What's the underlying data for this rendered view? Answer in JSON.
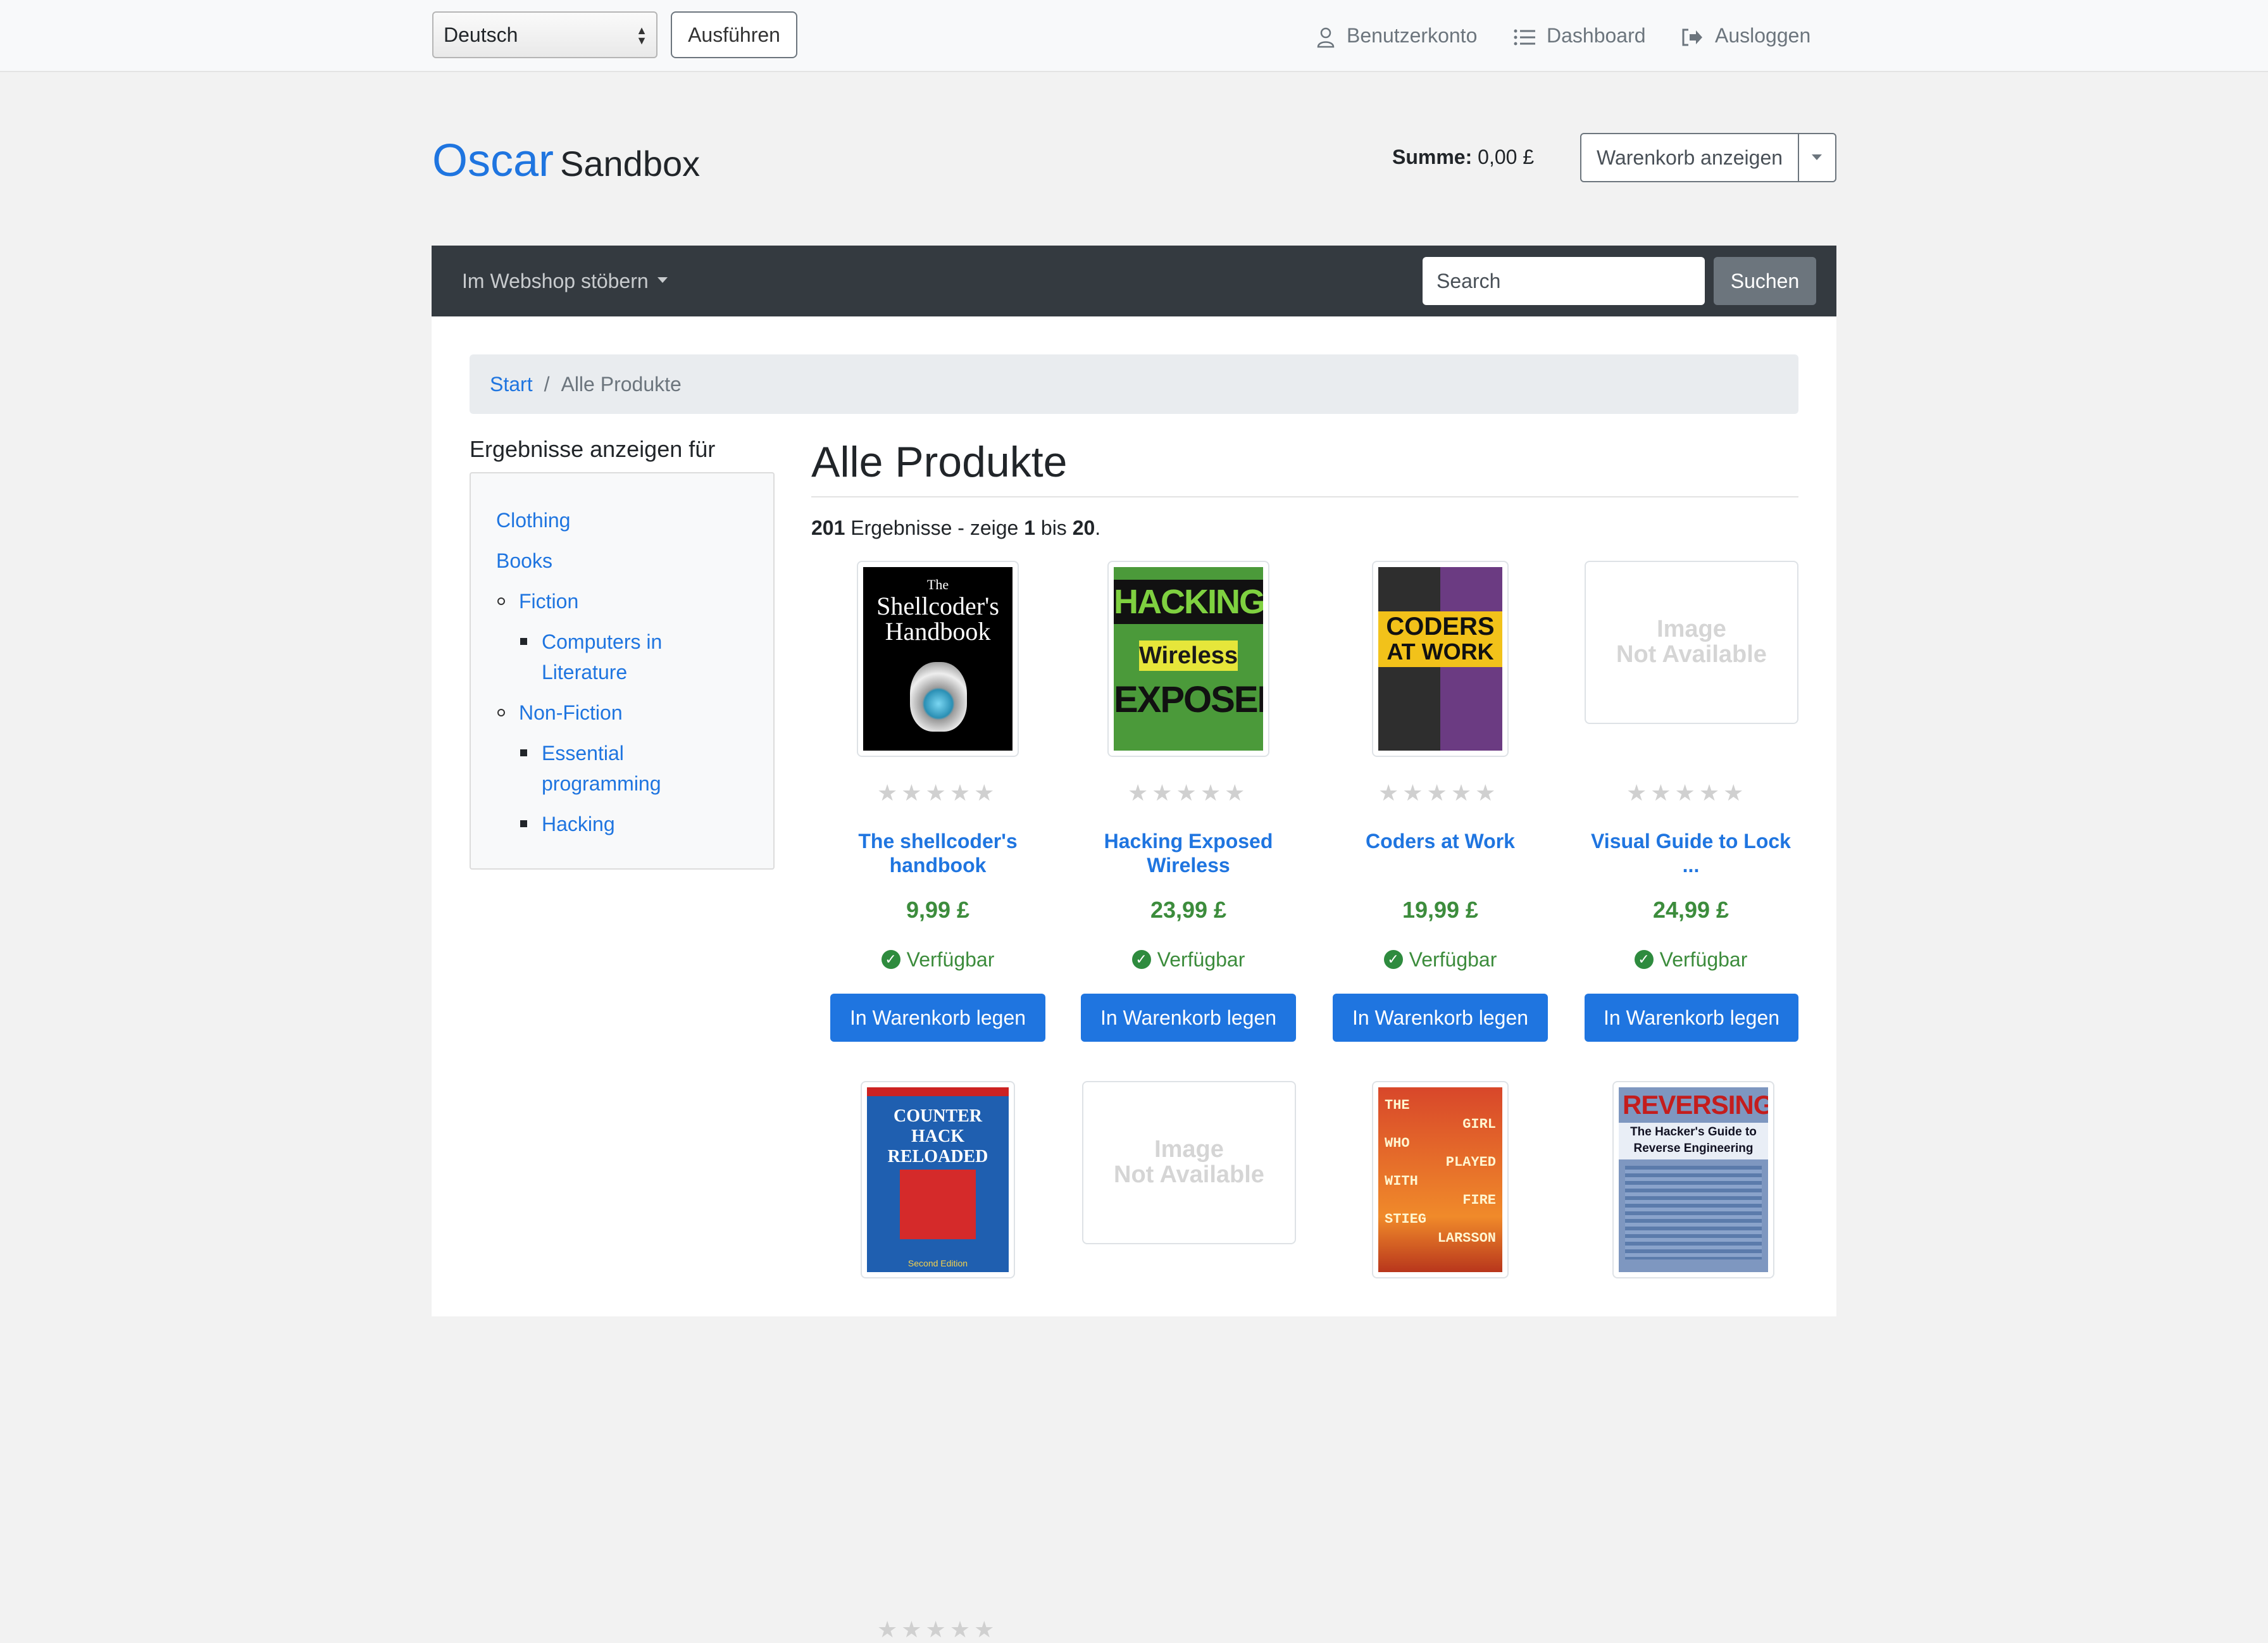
{
  "topbar": {
    "language": "Deutsch",
    "apply_label": "Ausführen",
    "account_label": "Benutzerkonto",
    "dashboard_label": "Dashboard",
    "logout_label": "Ausloggen"
  },
  "header": {
    "brand_primary": "Oscar",
    "brand_secondary": "Sandbox",
    "total_label": "Summe:",
    "total_value": "0,00 £",
    "basket_button": "Warenkorb anzeigen"
  },
  "nav": {
    "browse_label": "Im Webshop stöbern",
    "search_placeholder": "Search",
    "search_button": "Suchen"
  },
  "breadcrumb": {
    "home": "Start",
    "current": "Alle Produkte"
  },
  "filter": {
    "title": "Ergebnisse anzeigen für",
    "categories": {
      "clothing": "Clothing",
      "books": "Books",
      "fiction": "Fiction",
      "computers_lit_1": "Computers in",
      "computers_lit_2": "Literature",
      "non_fiction": "Non-Fiction",
      "essential_1": "Essential",
      "essential_2": "programming",
      "hacking": "Hacking"
    }
  },
  "main": {
    "title": "Alle Produkte",
    "results_count": "201",
    "results_mid": "Ergebnisse - zeige",
    "results_from": "1",
    "results_to_word": "bis",
    "results_to": "20",
    "results_end": "."
  },
  "products": [
    {
      "title_1": "The shellcoder's",
      "title_2": "handbook",
      "price": "9,99 £",
      "availability": "Verfügbar",
      "add_label": "In Warenkorb legen",
      "rating": 0,
      "cover_lines": [
        "The",
        "Shellcoder's",
        "Handbook"
      ]
    },
    {
      "title_1": "Hacking Exposed",
      "title_2": "Wireless",
      "price": "23,99 £",
      "availability": "Verfügbar",
      "add_label": "In Warenkorb legen",
      "rating": 0,
      "cover_lines": [
        "HACKING",
        "Wireless",
        "EXPOSED"
      ]
    },
    {
      "title_1": "Coders at Work",
      "title_2": "",
      "price": "19,99 £",
      "availability": "Verfügbar",
      "add_label": "In Warenkorb legen",
      "rating": 0,
      "cover_lines": [
        "CODERS",
        "AT WORK"
      ]
    },
    {
      "title_1": "Visual Guide to Lock ...",
      "title_2": "",
      "price": "24,99 £",
      "availability": "Verfügbar",
      "add_label": "In Warenkorb legen",
      "rating": 0,
      "placeholder_1": "Image",
      "placeholder_2": "Not Available"
    },
    {
      "cover_lines": [
        "COUNTER HACK",
        "RELOADED",
        "Second Edition"
      ]
    },
    {
      "placeholder_1": "Image",
      "placeholder_2": "Not Available"
    },
    {
      "cover_lines": [
        "THE",
        "GIRL",
        "WHO",
        "PLAYED",
        "WITH",
        "FIRE",
        "STIEG",
        "LARSSON"
      ]
    },
    {
      "cover_lines": [
        "REVERSING:",
        "The Hacker's Guide to",
        "Reverse Engineering"
      ]
    }
  ],
  "colors": {
    "brand_blue": "#1f75e0",
    "navbar": "#343a40",
    "price_green": "#3c8c3c"
  }
}
